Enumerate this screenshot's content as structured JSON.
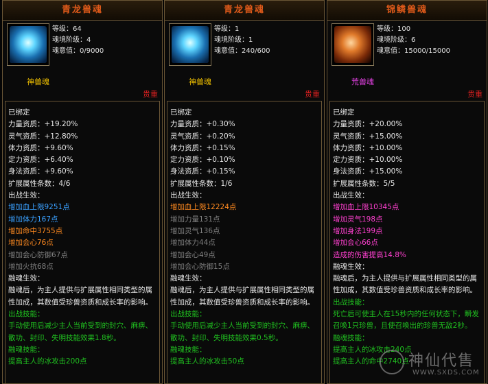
{
  "panels": [
    {
      "title": "青龙兽魂",
      "icon": "blue-dragon-soul-icon",
      "stats": [
        "等级：64",
        "魂境阶级：4",
        "魂意值：0/9000"
      ],
      "grade": "神兽魂",
      "precious": "贵重",
      "lines": [
        {
          "text": "已绑定",
          "c": "w"
        },
        {
          "text": "力量资质：+19.20%",
          "c": "w"
        },
        {
          "text": "灵气资质：+12.80%",
          "c": "w"
        },
        {
          "text": "体力资质：+9.60%",
          "c": "w"
        },
        {
          "text": "定力资质：+6.40%",
          "c": "w"
        },
        {
          "text": "身法资质：+9.60%",
          "c": "w"
        },
        {
          "text": "扩展属性条数：4/6",
          "c": "w"
        },
        {
          "text": "出战生效：",
          "c": "w"
        },
        {
          "text": "增加血上限9251点",
          "c": "blue"
        },
        {
          "text": "增加体力167点",
          "c": "blue"
        },
        {
          "text": "增加命中3755点",
          "c": "orange"
        },
        {
          "text": "增加会心76点",
          "c": "orange"
        },
        {
          "text": "增加会心防御67点",
          "c": "gray"
        },
        {
          "text": "增加火抗68点",
          "c": "gray"
        },
        {
          "text": "融魂生效：",
          "c": "w"
        },
        {
          "text": "融魂后，为主人提供与扩展属性相同类型的属性加成，其数值受珍兽资质和成长率的影响。",
          "c": "w",
          "wrap": true
        },
        {
          "text": "出战技能：",
          "c": "green"
        },
        {
          "text": "手动使用后减少主人当前受到的封穴、麻痹、散功、封印、失明技能效果1.8秒。",
          "c": "green",
          "wrap": true
        },
        {
          "text": "融魂技能：",
          "c": "green"
        },
        {
          "text": "提高主人的冰攻击200点",
          "c": "green"
        }
      ]
    },
    {
      "title": "青龙兽魂",
      "icon": "blue-dragon-soul-icon",
      "stats": [
        "等级：1",
        "魂境阶级：1",
        "魂意值：240/600"
      ],
      "grade": "神兽魂",
      "precious": "贵重",
      "lines": [
        {
          "text": "已绑定",
          "c": "w"
        },
        {
          "text": "力量资质：+0.30%",
          "c": "w"
        },
        {
          "text": "灵气资质：+0.20%",
          "c": "w"
        },
        {
          "text": "体力资质：+0.15%",
          "c": "w"
        },
        {
          "text": "定力资质：+0.10%",
          "c": "w"
        },
        {
          "text": "身法资质：+0.15%",
          "c": "w"
        },
        {
          "text": "扩展属性条数：1/6",
          "c": "w"
        },
        {
          "text": "出战生效：",
          "c": "w"
        },
        {
          "text": "增加血上限12224点",
          "c": "orange"
        },
        {
          "text": "增加力量131点",
          "c": "gray"
        },
        {
          "text": "增加灵气136点",
          "c": "gray"
        },
        {
          "text": "增加体力44点",
          "c": "gray"
        },
        {
          "text": "增加会心49点",
          "c": "gray"
        },
        {
          "text": "增加会心防御15点",
          "c": "gray"
        },
        {
          "text": "融魂生效：",
          "c": "w"
        },
        {
          "text": "融魂后，为主人提供与扩展属性相同类型的属性加成，其数值受珍兽资质和成长率的影响。",
          "c": "w",
          "wrap": true
        },
        {
          "text": "出战技能：",
          "c": "green"
        },
        {
          "text": "手动使用后减少主人当前受到的封穴、麻痹、散功、封印、失明技能效果0.5秒。",
          "c": "green",
          "wrap": true
        },
        {
          "text": "融魂技能：",
          "c": "green"
        },
        {
          "text": "提高主人的冰攻击50点",
          "c": "green"
        }
      ]
    },
    {
      "title": "锦鳞兽魂",
      "icon": "golden-fish-soul-icon",
      "stats": [
        "等级：100",
        "魂境阶级：6",
        "魂意值：15000/15000"
      ],
      "grade": "荒兽魂",
      "precious": "贵重",
      "lines": [
        {
          "text": "已绑定",
          "c": "w"
        },
        {
          "text": "力量资质：+20.00%",
          "c": "w"
        },
        {
          "text": "灵气资质：+15.00%",
          "c": "w"
        },
        {
          "text": "体力资质：+10.00%",
          "c": "w"
        },
        {
          "text": "定力资质：+10.00%",
          "c": "w"
        },
        {
          "text": "身法资质：+15.00%",
          "c": "w"
        },
        {
          "text": "扩展属性条数：5/5",
          "c": "w"
        },
        {
          "text": "出战生效：",
          "c": "w"
        },
        {
          "text": "增加血上限10345点",
          "c": "pink"
        },
        {
          "text": "增加灵气198点",
          "c": "pink"
        },
        {
          "text": "增加身法199点",
          "c": "pink"
        },
        {
          "text": "增加会心66点",
          "c": "pink"
        },
        {
          "text": "造成的伤害提高14.8%",
          "c": "pink"
        },
        {
          "text": "融魂生效：",
          "c": "w"
        },
        {
          "text": "融魂后，为主人提供与扩展属性相同类型的属性加成，其数值受珍兽资质和成长率的影响。",
          "c": "w",
          "wrap": true
        },
        {
          "text": "出战技能：",
          "c": "green"
        },
        {
          "text": "死亡后可使主人在15秒内的任何状态下，瞬发召唤1只珍兽，且使召唤出的珍兽无敌2秒。",
          "c": "green",
          "wrap": true
        },
        {
          "text": "融魂技能：",
          "c": "green"
        },
        {
          "text": "提高主人的冰攻击240点",
          "c": "green"
        },
        {
          "text": "提高主人的命中2740点",
          "c": "green"
        }
      ]
    }
  ],
  "watermark": {
    "text": "神仙代售",
    "url": "WWW.SXDS.COM"
  }
}
